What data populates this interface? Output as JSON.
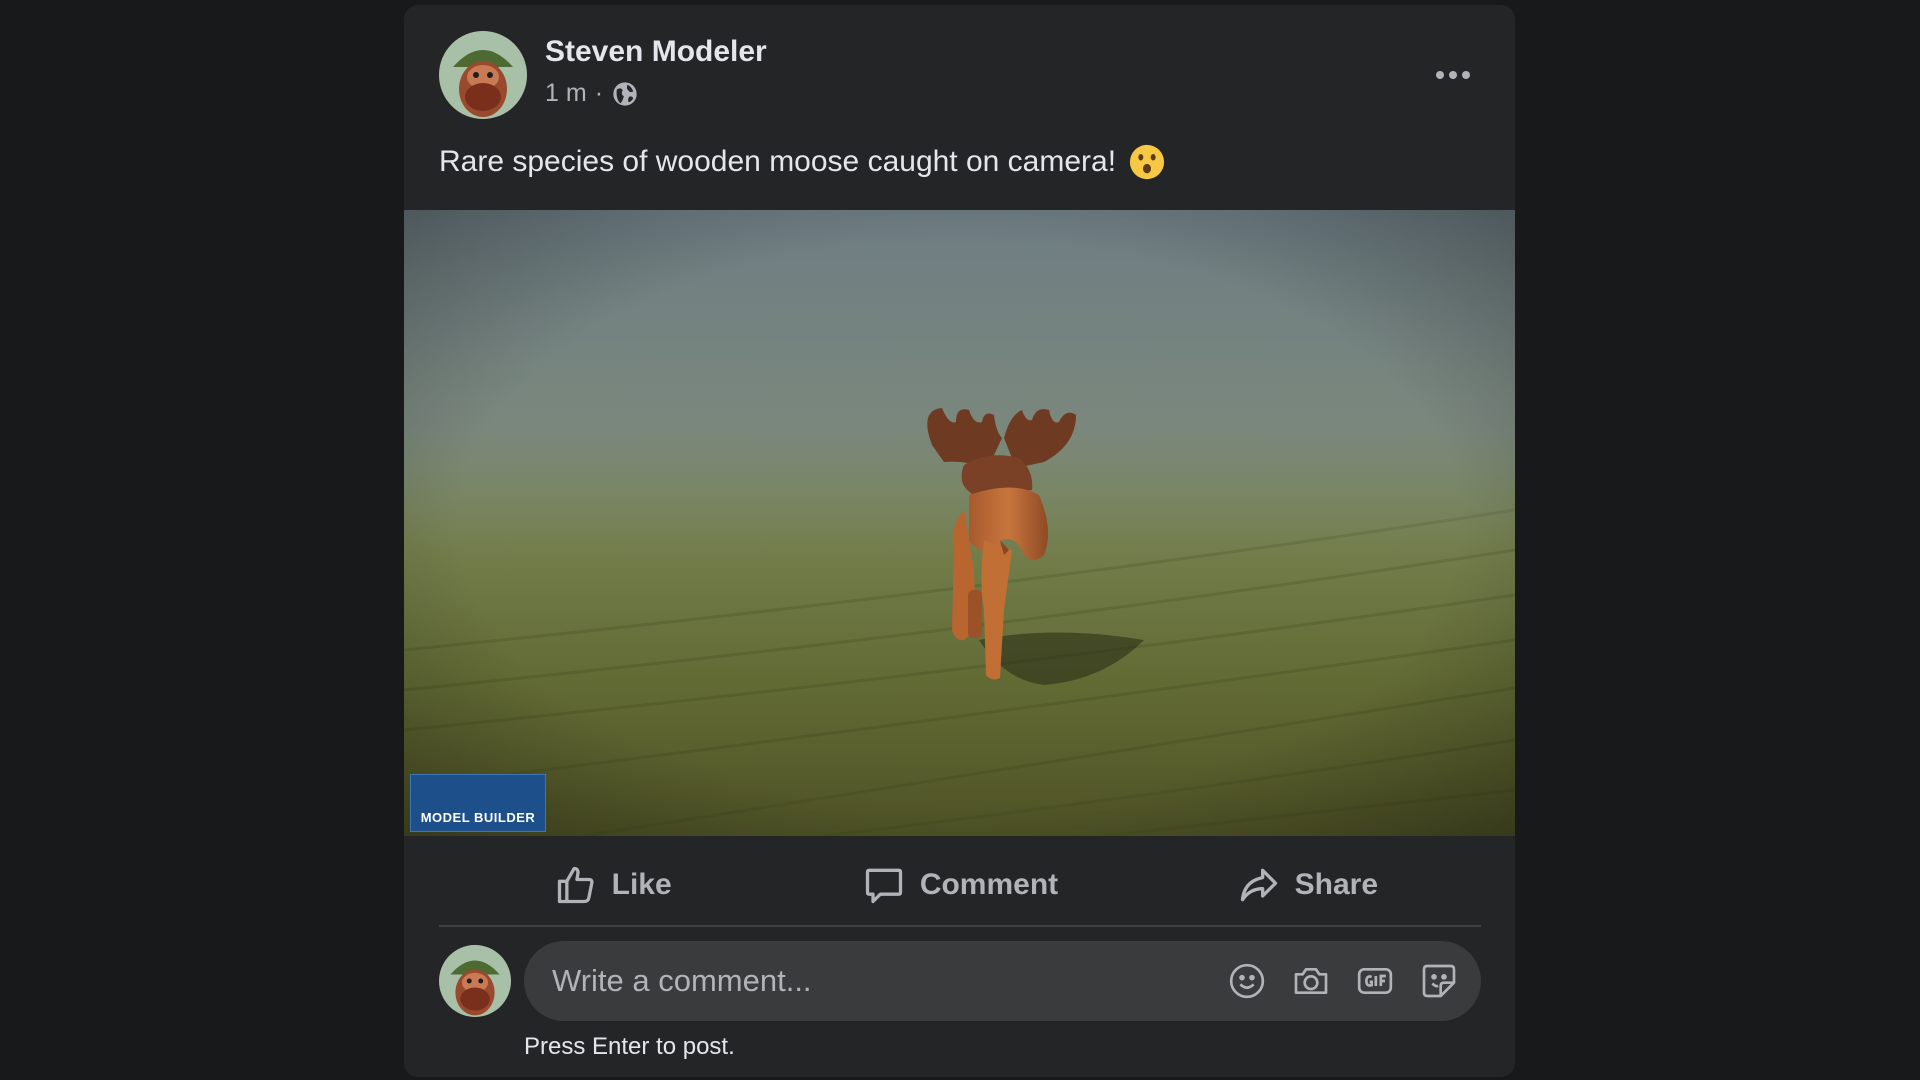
{
  "post": {
    "author": "Steven Modeler",
    "timestamp": "1 m",
    "separator": "·",
    "audience_icon": "globe-icon",
    "text": "Rare species of wooden moose caught on camera!",
    "emoji": "astonished-face-emoji",
    "media": {
      "watermark": "MODEL BUILDER"
    }
  },
  "actions": {
    "like": "Like",
    "comment": "Comment",
    "share": "Share"
  },
  "composer": {
    "placeholder": "Write a comment...",
    "hint": "Press Enter to post.",
    "icons": [
      "emoji-icon",
      "camera-icon",
      "gif-icon",
      "sticker-icon"
    ]
  },
  "colors": {
    "background": "#18191a",
    "card": "#242526",
    "input": "#3a3b3c",
    "text_primary": "#e4e6eb",
    "text_secondary": "#b0b3b8"
  }
}
